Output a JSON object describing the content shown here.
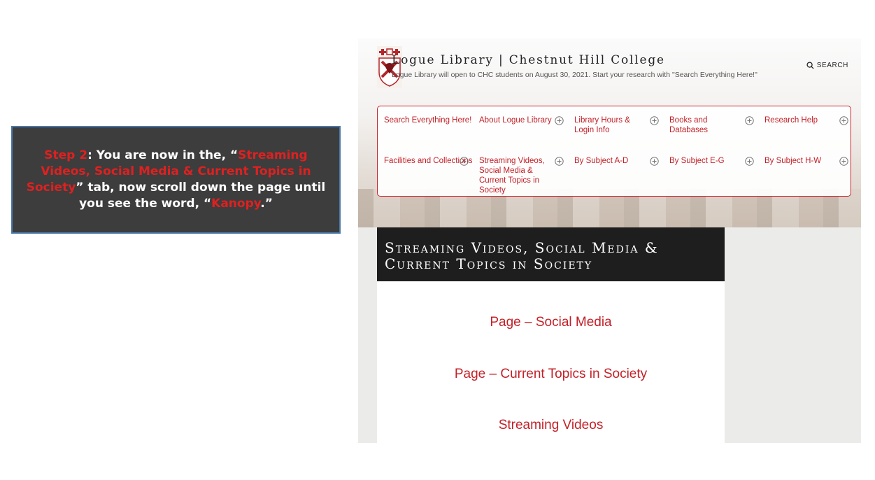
{
  "instruction": {
    "step": "Step 2",
    "part1": ": You are now in the, “",
    "tab_name": "Streaming Videos, Social Media & Current Topics in Society",
    "part2": "” tab, now scroll down the page until you see the  word, “",
    "keyword": "Kanopy",
    "part3": ".”"
  },
  "site": {
    "title": "Logue Library | Chestnut Hill College",
    "subtitle": "Logue Library will open to CHC students on August 30, 2021. Start your research with \"Search Everything Here!\"",
    "search_label": "SEARCH"
  },
  "nav": {
    "items": [
      {
        "label": "Search Everything Here!",
        "has_submenu": false
      },
      {
        "label": "About Logue Library",
        "has_submenu": true
      },
      {
        "label": "Library Hours & Login Info",
        "has_submenu": true
      },
      {
        "label": "Books and Databases",
        "has_submenu": true
      },
      {
        "label": "Research Help",
        "has_submenu": true
      },
      {
        "label": "Facilities and Collections",
        "has_submenu": true
      },
      {
        "label": "Streaming Videos, Social Media & Current Topics in Society",
        "has_submenu": true
      },
      {
        "label": "By Subject A-D",
        "has_submenu": true
      },
      {
        "label": "By Subject E-G",
        "has_submenu": true
      },
      {
        "label": "By Subject H-W",
        "has_submenu": true
      }
    ]
  },
  "page": {
    "title": "Streaming Videos, Social Media & Current Topics in Society",
    "links": [
      "Page – Social Media",
      "Page – Current Topics in Society",
      "Streaming Videos"
    ]
  },
  "colors": {
    "accent_red": "#c22128",
    "callout_bg": "#3d3d3d",
    "callout_border": "#4a78a8",
    "highlight_red": "#e02020"
  },
  "icons": {
    "search": "search-icon",
    "expand": "plus-circle-icon",
    "crest": "college-crest-icon"
  }
}
